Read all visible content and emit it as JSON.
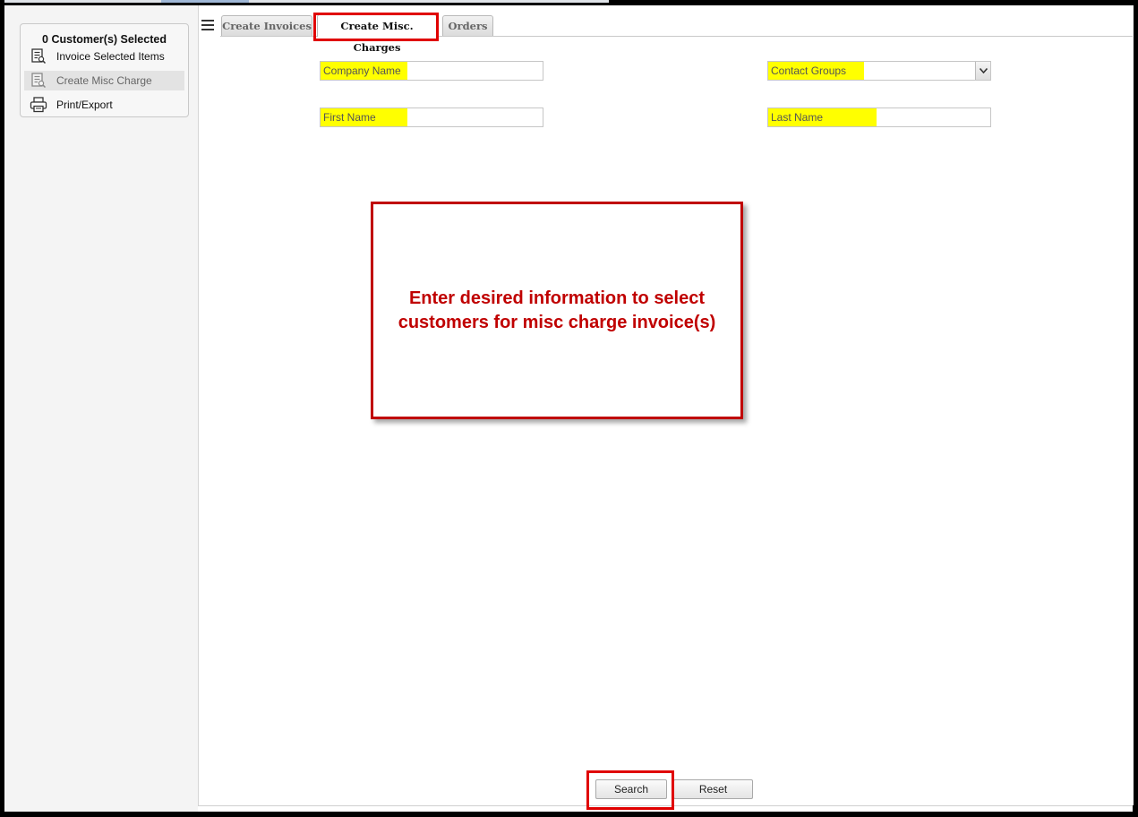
{
  "sidebar": {
    "title": "0 Customer(s) Selected",
    "items": [
      {
        "label": "Invoice Selected Items",
        "icon": "invoice-icon",
        "enabled": true
      },
      {
        "label": "Create Misc Charge",
        "icon": "misc-charge-icon",
        "enabled": false
      },
      {
        "label": "Print/Export",
        "icon": "printer-icon",
        "enabled": true
      }
    ]
  },
  "tabs": [
    {
      "label": "Create Invoices",
      "active": false
    },
    {
      "label": "Create Misc. Charges",
      "active": true
    },
    {
      "label": "Orders",
      "active": false
    }
  ],
  "form": {
    "company_name": {
      "placeholder": "Company Name",
      "value": ""
    },
    "contact_groups": {
      "placeholder": "Contact Groups",
      "value": ""
    },
    "first_name": {
      "placeholder": "First Name",
      "value": ""
    },
    "last_name": {
      "placeholder": "Last Name",
      "value": ""
    }
  },
  "callout": {
    "text": "Enter desired information to select customers for misc charge invoice(s)"
  },
  "buttons": {
    "search": "Search",
    "reset": "Reset"
  },
  "colors": {
    "highlight_red": "#e00000",
    "callout_red": "#c00000",
    "field_highlight": "#ffff00"
  }
}
